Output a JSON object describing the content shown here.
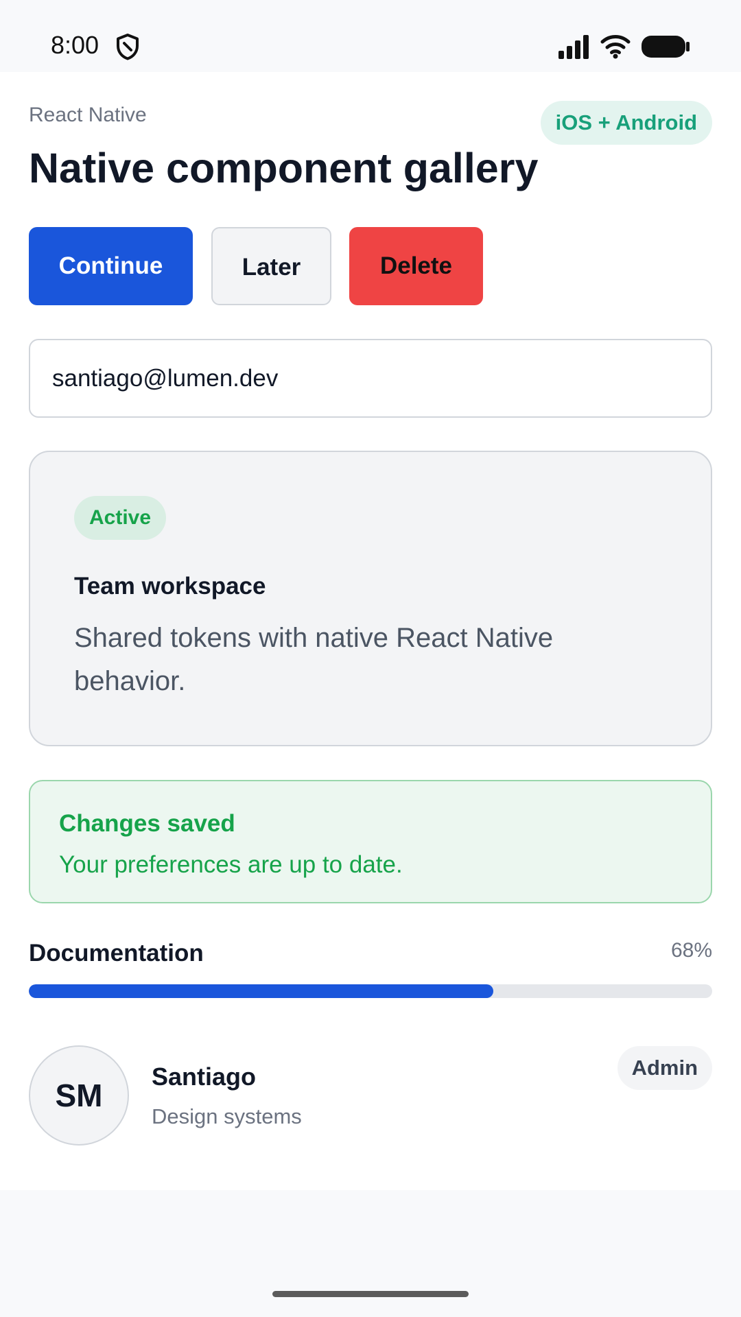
{
  "status_bar": {
    "time": "8:00",
    "icons": [
      "shield-icon",
      "signal-icon",
      "wifi-icon",
      "battery-icon"
    ]
  },
  "header": {
    "eyebrow": "React Native",
    "title": "Native component gallery",
    "platform_badge": "iOS + Android"
  },
  "actions": {
    "continue_label": "Continue",
    "later_label": "Later",
    "delete_label": "Delete"
  },
  "email_field": {
    "value": "santiago@lumen.dev"
  },
  "workspace_card": {
    "badge": "Active",
    "title": "Team workspace",
    "body": "Shared tokens with native React Native behavior."
  },
  "alert": {
    "title": "Changes saved",
    "message": "Your preferences are up to date."
  },
  "progress": {
    "label": "Documentation",
    "value_label": "68%",
    "value": 0.68
  },
  "user": {
    "initials": "SM",
    "name": "Santiago",
    "team": "Design systems",
    "role_badge": "Admin"
  },
  "colors": {
    "primary": "#1a56db",
    "danger": "#ef4444",
    "success": "#16a34a",
    "platform_accent": "#18a07a"
  }
}
